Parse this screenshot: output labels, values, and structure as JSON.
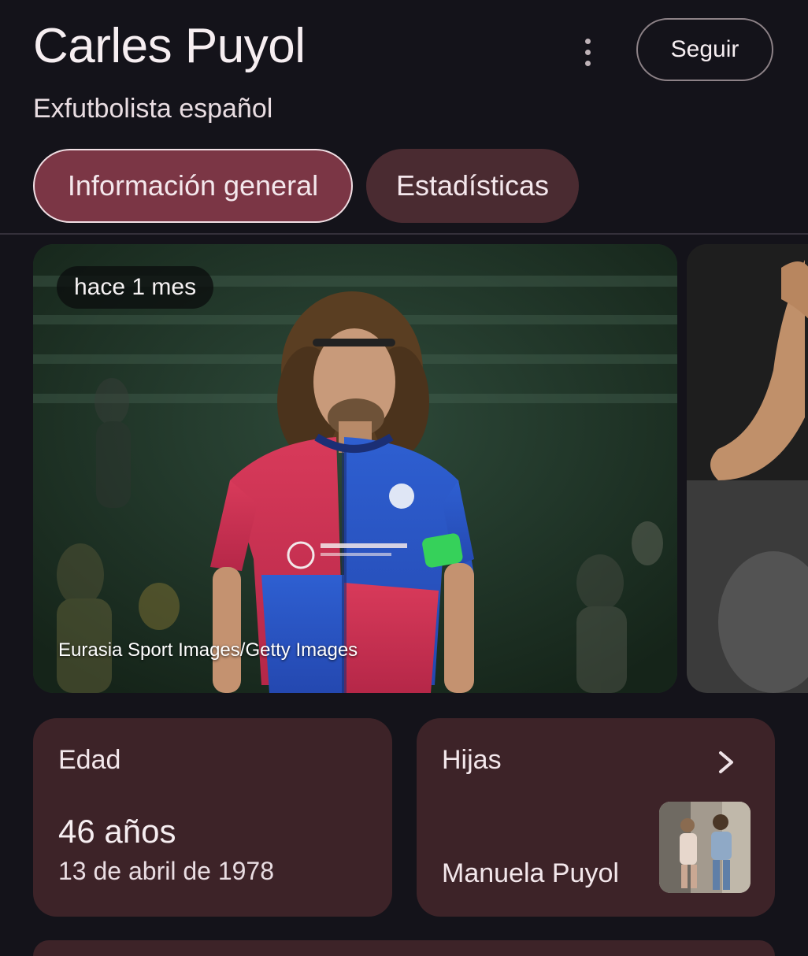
{
  "header": {
    "title": "Carles Puyol",
    "subtitle": "Exfutbolista español",
    "follow_label": "Seguir",
    "more_icon": "more-vert-icon"
  },
  "tabs": [
    {
      "label": "Información general",
      "active": true
    },
    {
      "label": "Estadísticas",
      "active": false
    }
  ],
  "gallery": {
    "main_photo": {
      "time_ago": "hace 1 mes",
      "credit": "Eurasia Sport Images/Getty Images"
    }
  },
  "facts": {
    "age": {
      "label": "Edad",
      "value": "46 años",
      "birth_date": "13 de abril de 1978"
    },
    "daughters": {
      "label": "Hijas",
      "name": "Manuela Puyol",
      "chevron_icon": "chevron-right-icon"
    }
  },
  "colors": {
    "background": "#14131a",
    "chip_active": "#7b3645",
    "chip_inactive": "#4a2b31",
    "card": "#3d2328"
  }
}
